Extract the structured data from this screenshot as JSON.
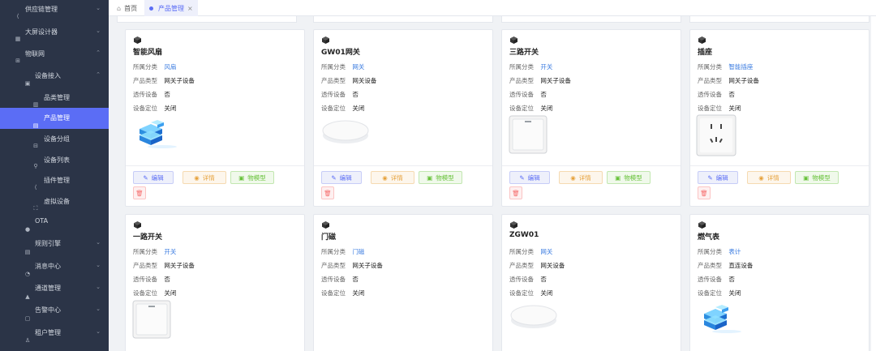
{
  "sidebar": {
    "items": [
      {
        "label": "供应链管理",
        "icon": "share-icon",
        "chevron": "⌄"
      },
      {
        "label": "大屏设计器",
        "icon": "grid-icon",
        "chevron": "⌄"
      },
      {
        "label": "物联网",
        "icon": "iot-icon",
        "chevron": "⌃"
      },
      {
        "label": "设备接入",
        "icon": "device-icon",
        "chevron": "⌃"
      },
      {
        "label": "品类管理",
        "icon": "category-icon",
        "chevron": ""
      },
      {
        "label": "产品管理",
        "icon": "product-icon",
        "chevron": ""
      },
      {
        "label": "设备分组",
        "icon": "group-icon",
        "chevron": ""
      },
      {
        "label": "设备列表",
        "icon": "list-icon",
        "chevron": ""
      },
      {
        "label": "插件管理",
        "icon": "plugin-icon",
        "chevron": ""
      },
      {
        "label": "虚拟设备",
        "icon": "virtual-icon",
        "chevron": ""
      },
      {
        "label": "OTA",
        "icon": "ota-icon",
        "chevron": ""
      },
      {
        "label": "规则引擎",
        "icon": "rule-icon",
        "chevron": "⌄"
      },
      {
        "label": "消息中心",
        "icon": "message-icon",
        "chevron": "⌄"
      },
      {
        "label": "通道管理",
        "icon": "channel-icon",
        "chevron": "⌄"
      },
      {
        "label": "告警中心",
        "icon": "alarm-icon",
        "chevron": "⌄"
      },
      {
        "label": "租户管理",
        "icon": "tenant-icon",
        "chevron": "⌄"
      }
    ]
  },
  "tabs": [
    {
      "label": "首页",
      "icon": "home-icon"
    },
    {
      "label": "产品管理",
      "close": "×"
    }
  ],
  "labels": {
    "category": "所属分类",
    "type": "产品类型",
    "passthrough": "透传设备",
    "location": "设备定位",
    "edit": "编辑",
    "detail": "详情",
    "model": "物模型"
  },
  "cards": [
    {
      "title": "智能风扇",
      "category": "风扇",
      "type": "网关子设备",
      "passthrough": "否",
      "location": "关闭",
      "image": "cube-stack"
    },
    {
      "title": "GW01网关",
      "category": "网关",
      "type": "网关设备",
      "passthrough": "否",
      "location": "关闭",
      "image": "disc"
    },
    {
      "title": "三路开关",
      "category": "开关",
      "type": "网关子设备",
      "passthrough": "否",
      "location": "关闭",
      "image": "switch"
    },
    {
      "title": "插座",
      "category": "智能插座",
      "type": "网关子设备",
      "passthrough": "否",
      "location": "关闭",
      "image": "socket"
    },
    {
      "title": "一路开关",
      "category": "开关",
      "type": "网关子设备",
      "passthrough": "否",
      "location": "关闭",
      "image": "switch"
    },
    {
      "title": "门磁",
      "category": "门磁",
      "type": "网关子设备",
      "passthrough": "否",
      "location": "关闭",
      "image": "none"
    },
    {
      "title": "ZGW01",
      "category": "网关",
      "type": "网关设备",
      "passthrough": "否",
      "location": "关闭",
      "image": "disc"
    },
    {
      "title": "燃气表",
      "category": "表计",
      "type": "直连设备",
      "passthrough": "否",
      "location": "关闭",
      "image": "cube-stack"
    }
  ],
  "colors": {
    "sidebar_bg": "#2b3447",
    "accent": "#5b6df5",
    "link": "#3a7be0"
  }
}
